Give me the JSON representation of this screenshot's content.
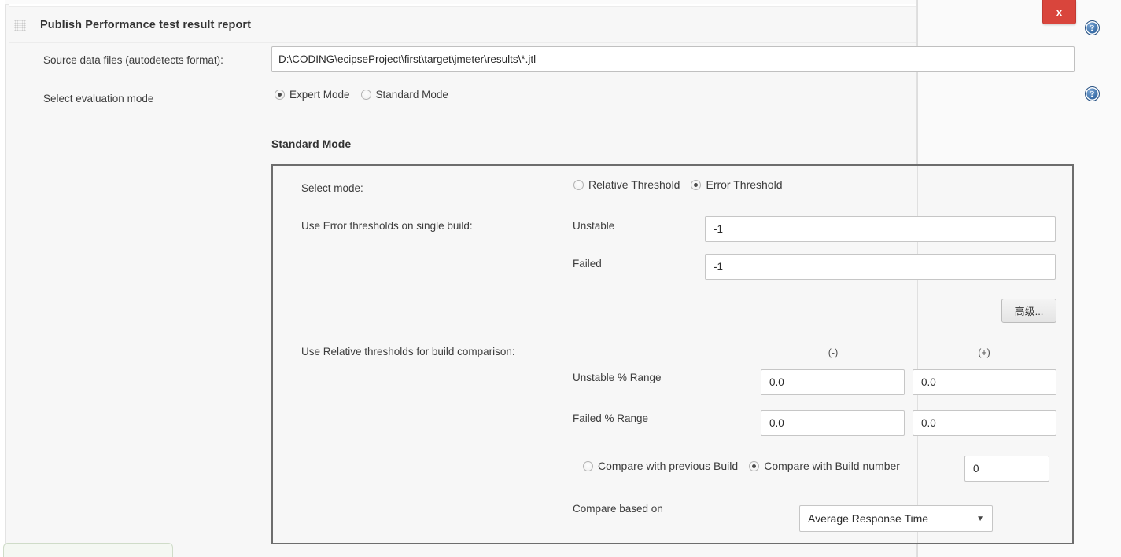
{
  "window": {
    "close_label": "x",
    "drag_handle_icon": "grid-drag-handle-icon"
  },
  "header": {
    "title": "Publish Performance test result report"
  },
  "help": {
    "glyph": "?",
    "source_icon_name": "help-icon",
    "mode_icon_name": "help-icon"
  },
  "source_data": {
    "label": "Source data files (autodetects format):",
    "value": "D:\\CODING\\ecipseProject\\first\\target\\jmeter\\results\\*.jtl",
    "placeholder": ""
  },
  "evaluation_mode": {
    "label": "Select evaluation mode",
    "options": [
      {
        "label": "Expert Mode",
        "checked": true
      },
      {
        "label": "Standard Mode",
        "checked": false
      }
    ]
  },
  "standard_mode": {
    "heading": "Standard Mode",
    "select_mode": {
      "label": "Select mode:",
      "options": [
        {
          "label": "Relative Threshold",
          "checked": false
        },
        {
          "label": "Error Threshold",
          "checked": true
        }
      ]
    },
    "error_thresholds": {
      "label": "Use Error thresholds on single build:",
      "unstable_label": "Unstable",
      "unstable_value": "-1",
      "failed_label": "Failed",
      "failed_value": "-1",
      "advanced_button_label": "高级..."
    },
    "relative_thresholds": {
      "label": "Use Relative thresholds for build comparison:",
      "column_minus": "(-)",
      "column_plus": "(+)",
      "unstable_range_label": "Unstable % Range",
      "unstable_minus_value": "0.0",
      "unstable_plus_value": "0.0",
      "failed_range_label": "Failed % Range",
      "failed_minus_value": "0.0",
      "failed_plus_value": "0.0"
    },
    "compare_build": {
      "options": [
        {
          "label": "Compare with previous Build",
          "checked": false
        },
        {
          "label": "Compare with Build number",
          "checked": true
        }
      ],
      "build_number_value": "0"
    },
    "compare_based_on": {
      "label": "Compare based on",
      "selected": "Average Response Time",
      "arrow_glyph": "▼"
    }
  },
  "colors": {
    "close_button": "#d9453c",
    "help_icon": "#3b6fa8",
    "panel_border": "#6d6d6d",
    "background": "#f7f7f7"
  }
}
